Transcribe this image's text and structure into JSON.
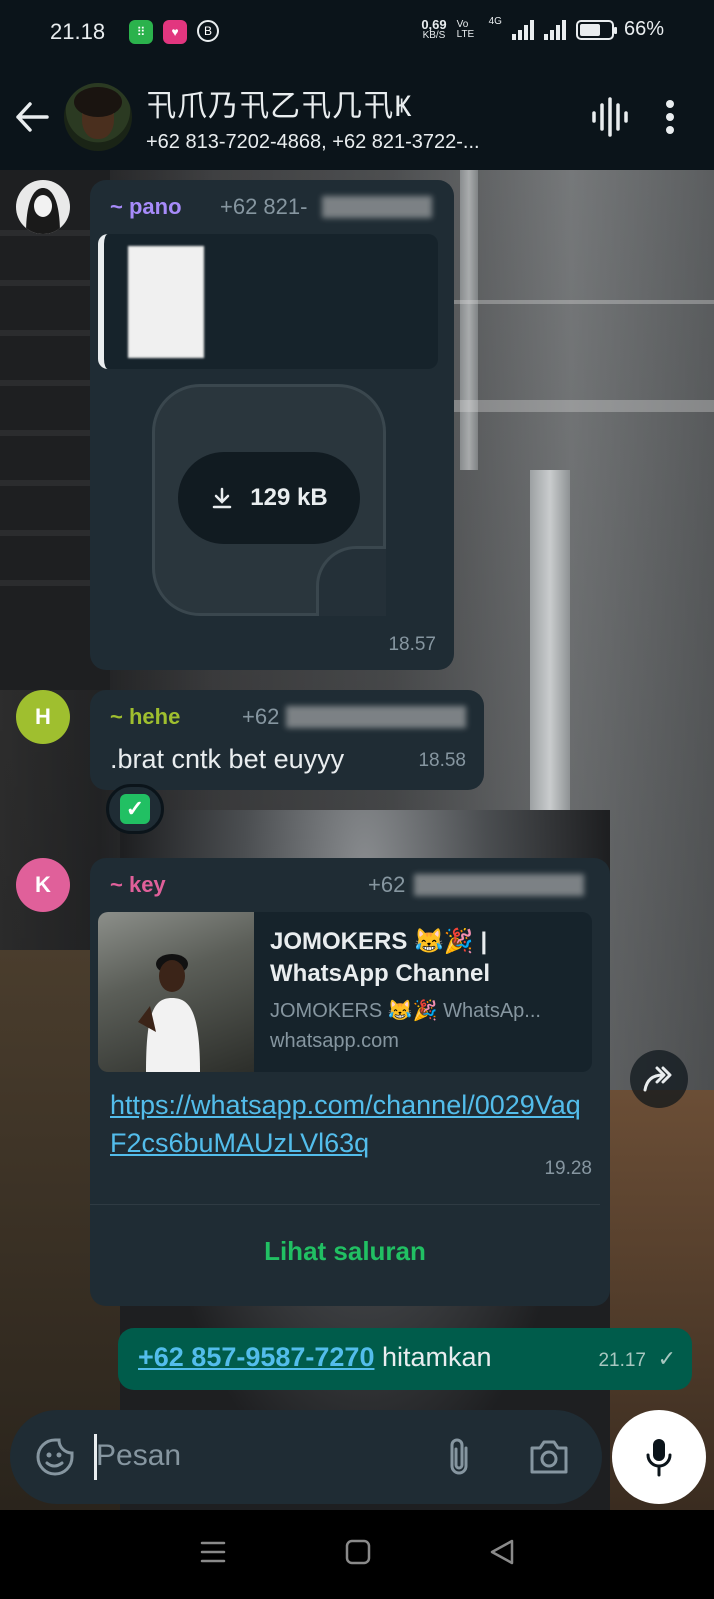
{
  "status_bar": {
    "time": "21.18",
    "net_speed_value": "0,69",
    "net_speed_unit": "KB/S",
    "volte": "Vo LTE",
    "network": "4G",
    "battery": "66%",
    "battery_level": 0.66
  },
  "header": {
    "title": "卂爪乃卂乙卂几卂Ҝ",
    "members": "+62 813-7202-4868, +62 821-3722-..."
  },
  "messages": [
    {
      "sender": "~ pano",
      "sender_color": "#a78bfa",
      "number": "+62 821-",
      "attachment_size": "129 kB",
      "time": "18.57"
    },
    {
      "avatar_letter": "H",
      "sender": "~ hehe",
      "sender_color": "#9fbf2f",
      "number": "+62",
      "text": ".brat cntk bet euyyy",
      "time": "18.58",
      "reaction": "✅"
    },
    {
      "avatar_letter": "K",
      "sender": "~ key",
      "sender_color": "#e0609a",
      "number": "+62",
      "link_title": "JOMOKERS 😹🎉 | WhatsApp Channel",
      "link_desc": "JOMOKERS 😹🎉 WhatsAp...",
      "link_domain": "whatsapp.com",
      "link_url": "https://whatsapp.com/channel/0029VaqF2cs6buMAUzLVl63q",
      "time": "19.28",
      "action": "Lihat saluran"
    },
    {
      "outgoing": true,
      "mention": "+62 857-9587-7270",
      "text": " hitamkan",
      "time": "21.17"
    }
  ],
  "composer": {
    "placeholder": "Pesan"
  },
  "colors": {
    "accent_green": "#21c063",
    "link_blue": "#53bdeb",
    "bubble_in": "#1f2c34",
    "bubble_out": "#005c4b"
  }
}
